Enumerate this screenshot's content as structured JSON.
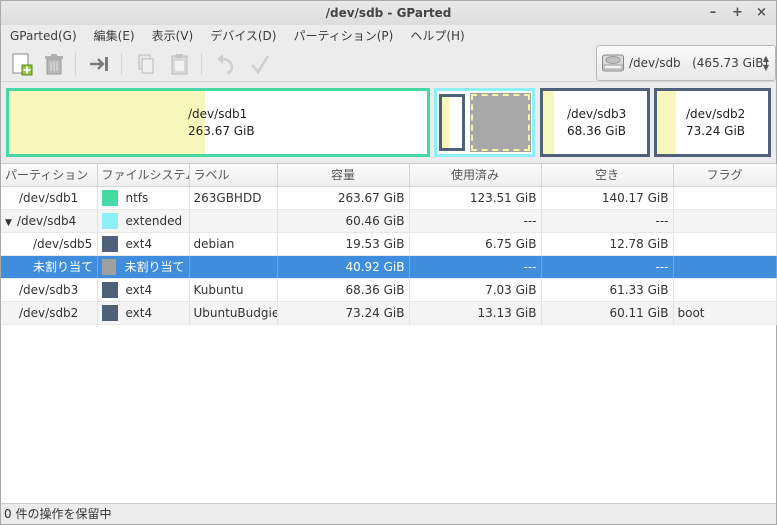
{
  "window": {
    "title": "/dev/sdb - GParted",
    "minimize": "–",
    "maximize": "+",
    "close": "×"
  },
  "menu": [
    "GParted(G)",
    "編集(E)",
    "表示(V)",
    "デバイス(D)",
    "パーティション(P)",
    "ヘルプ(H)"
  ],
  "toolbar": {
    "icons": [
      "new-partition-icon",
      "delete-icon",
      "resize-move-icon",
      "copy-icon",
      "paste-icon",
      "undo-icon",
      "apply-icon"
    ]
  },
  "device_selector": {
    "value": "/dev/sdb   (465.73 GiB)"
  },
  "partition_map": [
    {
      "name": "/dev/sdb1",
      "size": "263.67 GiB",
      "border_color": "#46d9a4",
      "used_fraction": 0.47
    },
    {
      "name": "/dev/sdb4",
      "size": "",
      "border_color": "#8cf0f4"
    },
    {
      "name": "/dev/sdb5",
      "size": "",
      "border_color": "#4e6179",
      "used_fraction": 0.35
    },
    {
      "name": "未割り当て",
      "size": "",
      "border_color": "#a0a0a0"
    },
    {
      "name": "/dev/sdb3",
      "size": "68.36 GiB",
      "border_color": "#4e6179",
      "used_fraction": 0.1
    },
    {
      "name": "/dev/sdb2",
      "size": "73.24 GiB",
      "border_color": "#4e6179",
      "used_fraction": 0.18
    }
  ],
  "table": {
    "headers": {
      "partition": "パーティション",
      "filesystem": "ファイルシステム",
      "label": "ラベル",
      "size": "容量",
      "used": "使用済み",
      "free": "空き",
      "flags": "フラグ"
    },
    "rows": [
      {
        "partition": "/dev/sdb1",
        "fs": "ntfs",
        "fs_color": "#46d9a4",
        "label": "263GBHDD",
        "size": "263.67 GiB",
        "used": "123.51 GiB",
        "free": "140.17 GiB",
        "flags": ""
      },
      {
        "partition": "/dev/sdb4",
        "fs": "extended",
        "fs_color": "#8cf0f4",
        "label": "",
        "size": "60.46 GiB",
        "used": "---",
        "free": "---",
        "flags": "",
        "expander": "▼"
      },
      {
        "partition": "/dev/sdb5",
        "fs": "ext4",
        "fs_color": "#4e6179",
        "label": "debian",
        "size": "19.53 GiB",
        "used": "6.75 GiB",
        "free": "12.78 GiB",
        "flags": ""
      },
      {
        "partition": "未割り当て",
        "fs": "未割り当て",
        "fs_color": "#a0a0a0",
        "label": "",
        "size": "40.92 GiB",
        "used": "---",
        "free": "---",
        "flags": ""
      },
      {
        "partition": "/dev/sdb3",
        "fs": "ext4",
        "fs_color": "#4e6179",
        "label": "Kubuntu",
        "size": "68.36 GiB",
        "used": "7.03 GiB",
        "free": "61.33 GiB",
        "flags": ""
      },
      {
        "partition": "/dev/sdb2",
        "fs": "ext4",
        "fs_color": "#4e6179",
        "label": "UbuntuBudgie",
        "size": "73.24 GiB",
        "used": "13.13 GiB",
        "free": "60.11 GiB",
        "flags": "boot"
      }
    ]
  },
  "status": "0 件の操作を保留中"
}
